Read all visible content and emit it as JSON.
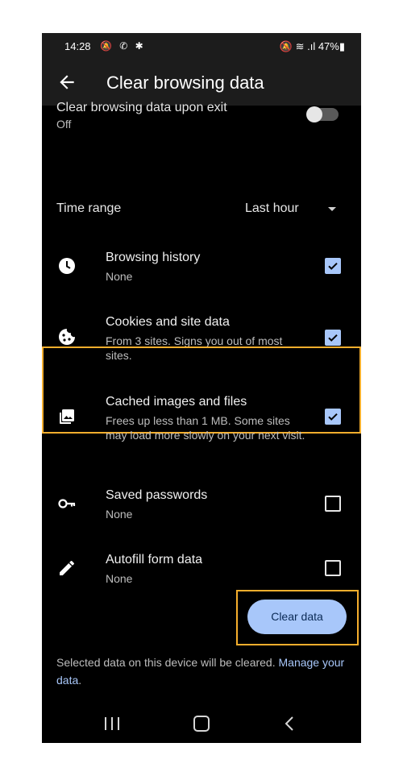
{
  "status_bar": {
    "time": "14:28",
    "left_indicators": "🔕 ✆ ✱",
    "right_indicators": "🔕 ≋ .ıl 47%▮"
  },
  "app_bar": {
    "title": "Clear browsing data"
  },
  "exit_setting": {
    "title": "Clear browsing data upon exit",
    "value": "Off",
    "enabled": false
  },
  "time_range": {
    "label": "Time range",
    "value": "Last hour"
  },
  "items": [
    {
      "icon": "clock-icon",
      "label": "Browsing history",
      "desc": "None",
      "checked": true
    },
    {
      "icon": "cookie-icon",
      "label": "Cookies and site data",
      "desc": "From 3 sites. Signs you out of most sites.",
      "checked": true
    },
    {
      "icon": "image-icon",
      "label": "Cached images and files",
      "desc": "Frees up less than 1 MB. Some sites may load more slowly on your next visit.",
      "checked": true
    },
    {
      "icon": "key-icon",
      "label": "Saved passwords",
      "desc": "None",
      "checked": false
    },
    {
      "icon": "pencil-icon",
      "label": "Autofill form data",
      "desc": "None",
      "checked": false
    }
  ],
  "clear_button": {
    "label": "Clear data"
  },
  "footer": {
    "text": "Selected data on this device will be cleared. ",
    "link": "Manage your data",
    "suffix": "."
  },
  "colors": {
    "accent": "#a8c7fa",
    "highlight": "#f6ae2d",
    "background": "#000000"
  }
}
